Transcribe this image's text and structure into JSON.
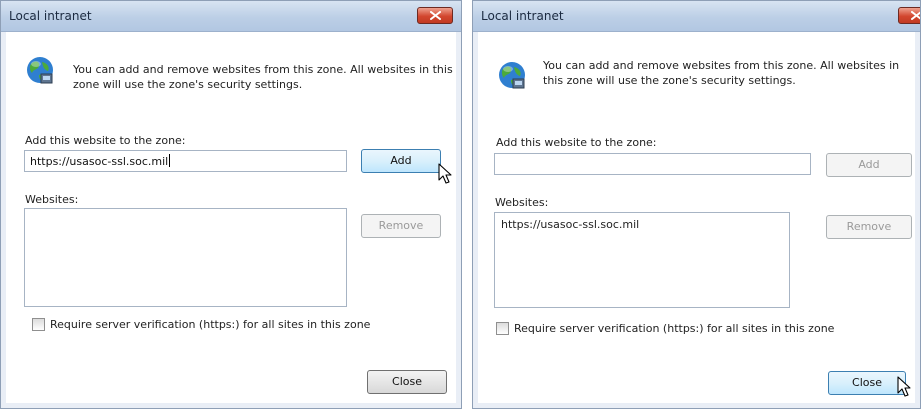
{
  "dialogs": [
    {
      "title": "Local intranet",
      "intro": "You can add and remove websites from this zone. All websites in this zone will use the zone's security settings.",
      "add_label": "Add this website to the zone:",
      "add_input_value": "https://usasoc-ssl.soc.mil",
      "add_button": "Add",
      "websites_label": "Websites:",
      "websites": [],
      "remove_button": "Remove",
      "require_https_label": "Require server verification (https:) for all sites in this zone",
      "require_https_checked": false,
      "close_button": "Close"
    },
    {
      "title": "Local intranet",
      "intro": "You can add and remove websites from this zone. All websites in this zone will use the zone's security settings.",
      "add_label": "Add this website to the zone:",
      "add_input_value": "",
      "add_button": "Add",
      "websites_label": "Websites:",
      "websites": [
        "https://usasoc-ssl.soc.mil"
      ],
      "remove_button": "Remove",
      "require_https_label": "Require server verification (https:) for all sites in this zone",
      "require_https_checked": false,
      "close_button": "Close"
    }
  ],
  "icons": {
    "zone": "globe-icon",
    "window_close": "close-icon",
    "pointer": "mouse-cursor-icon"
  },
  "colors": {
    "title_bar": "#bccfe6",
    "close_button_red": "#d2472f",
    "hot_button_blue": "#bee6fd",
    "disabled_text": "#9a9a9a"
  }
}
